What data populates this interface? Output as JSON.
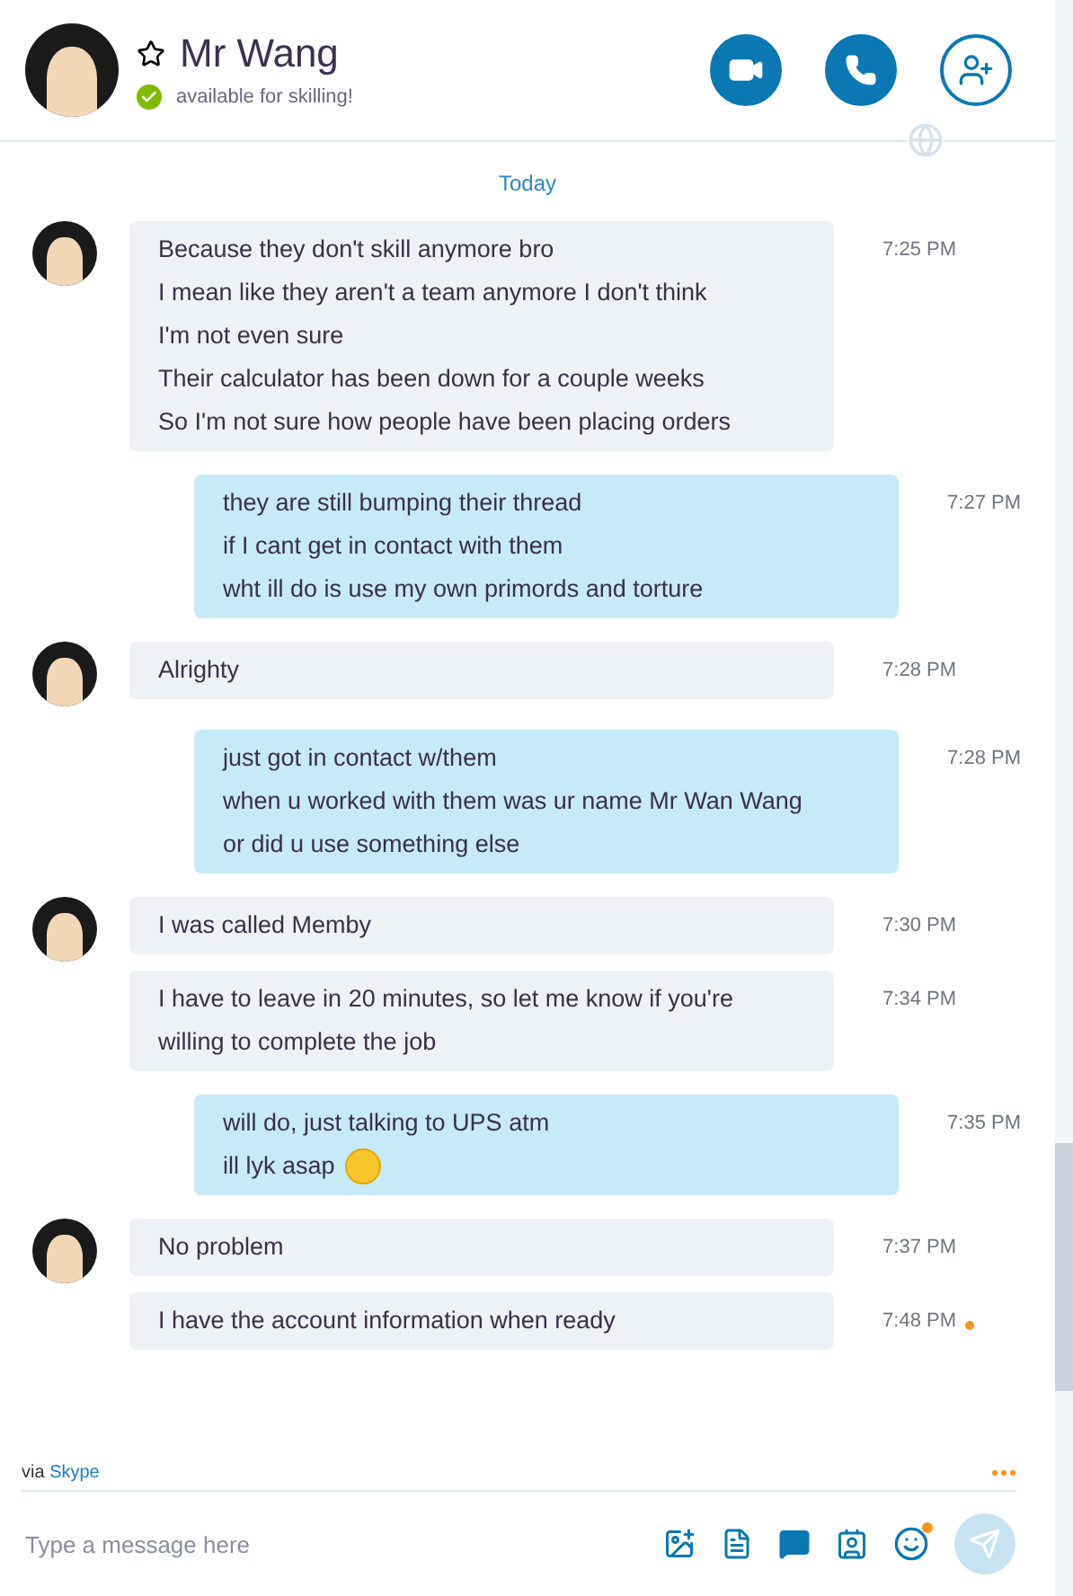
{
  "contact": {
    "name": "Mr Wang",
    "status": "available for skilling!"
  },
  "day_label": "Today",
  "messages": [
    {
      "kind": "incoming",
      "avatar": true,
      "lines": [
        "Because they don't skill anymore bro",
        "I mean like they aren't a team anymore I don't think",
        "I'm not even sure",
        "Their calculator has been down for a couple weeks",
        "So I'm not sure how people have been placing orders"
      ],
      "time": "7:25 PM",
      "unread": false
    },
    {
      "kind": "outgoing",
      "lines": [
        "they are still bumping their thread",
        "if I cant get in contact with them",
        "wht ill do is use my own primords and torture"
      ],
      "time": "7:27 PM",
      "unread": false
    },
    {
      "kind": "incoming",
      "avatar": true,
      "lines": [
        "Alrighty"
      ],
      "time": "7:28 PM",
      "unread": false
    },
    {
      "kind": "outgoing",
      "lines": [
        "just got in contact w/them",
        "when u worked with them was ur name Mr Wan Wang",
        "or did u use something else"
      ],
      "time": "7:28 PM",
      "unread": false
    },
    {
      "kind": "incoming",
      "avatar": true,
      "lines": [
        "I was called Memby"
      ],
      "time": "7:30 PM",
      "unread": false
    },
    {
      "kind": "incoming",
      "avatar": false,
      "lines": [
        "I have to leave in 20 minutes, so let me know if you're willing to complete the job"
      ],
      "time": "7:34 PM",
      "unread": false
    },
    {
      "kind": "outgoing",
      "lines": [
        "will do, just talking to UPS atm",
        "ill lyk asap"
      ],
      "emoji": true,
      "time": "7:35 PM",
      "unread": false
    },
    {
      "kind": "incoming",
      "avatar": true,
      "lines": [
        "No problem"
      ],
      "time": "7:37 PM",
      "unread": false
    },
    {
      "kind": "incoming",
      "avatar": false,
      "lines": [
        "I have the account information when ready"
      ],
      "time": "7:48 PM",
      "unread": true
    }
  ],
  "via": {
    "prefix": "via",
    "service": "Skype"
  },
  "composer": {
    "placeholder": "Type a message here"
  }
}
